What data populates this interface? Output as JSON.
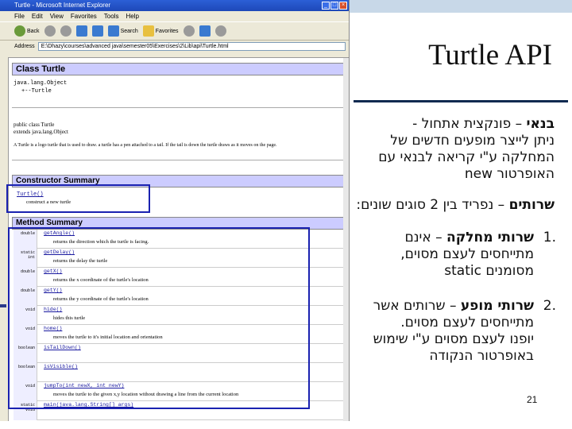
{
  "slide": {
    "title": "Turtle API",
    "block1": {
      "bold": "בנאי",
      "rest_line1": " – פונקצית אתחול -",
      "line2": "ניתן לייצר מופעים חדשים של",
      "line3": "המחלקה ע\"י קריאה לבנאי עם",
      "line4": "האופרטור new"
    },
    "block2": {
      "bold": "שרותים",
      "rest": " – נפריד בין 2 סוגים שונים:"
    },
    "item1": {
      "number": "1.",
      "bold": "שרותי מחלקה",
      "line1_rest": " – אינם",
      "line2": "מתייחסים לעצם מסוים,",
      "line3": "מסומנים static"
    },
    "item2": {
      "number": "2.",
      "bold": "שרותי מופע",
      "line1_rest": " – שרותים אשר",
      "line2": "מתייחסים לעצם מסוים.",
      "line3": "יופנו לעצם מסוים ע\"י שימוש",
      "line4": "באופרטור הנקודה"
    },
    "page_number": "21",
    "colors": {
      "title_rule": "#102a50",
      "highlight_box": "#1a22b0"
    }
  },
  "browser": {
    "title": "Turtle - Microsoft Internet Explorer",
    "window_buttons": [
      "_",
      "□",
      "×"
    ],
    "menu": [
      "File",
      "Edit",
      "View",
      "Favorites",
      "Tools",
      "Help"
    ],
    "toolbar": {
      "back": "Back",
      "search": "Search",
      "favorites": "Favorites"
    },
    "address_label": "Address",
    "address_value": "E:\\Dhazy\\courses\\advanced java\\semester05\\Exercises\\2\\Lib\\api\\Turtle.html",
    "page": {
      "class_title": "Class Turtle",
      "hierarchy_1": "java.lang.Object",
      "hierarchy_2": "+--Turtle",
      "decl_1": "public class Turtle",
      "decl_2": "extends java.lang.Object",
      "description": "A Turtle is a logo turtle that is used to draw. a turtle has a pen attached to a tail. If the tail is down the turtle draws as it moves on the page.",
      "constructor_header": "Constructor Summary",
      "constructor_sig": "Turtle()",
      "constructor_desc": "construct a new turtle",
      "method_header": "Method Summary",
      "methods": [
        {
          "modifier": "double",
          "sig": "getAngle()",
          "desc": "returns the direction which the turtle is facing."
        },
        {
          "modifier": "static int",
          "sig": "getDelay()",
          "desc": "returns the delay the turtle"
        },
        {
          "modifier": "double",
          "sig": "getX()",
          "desc": "returns the x coordinate of the turtle's location"
        },
        {
          "modifier": "double",
          "sig": "getY()",
          "desc": "returns the y coordinate of the turtle's location"
        },
        {
          "modifier": "void",
          "sig": "hide()",
          "desc": "hides this turtle"
        },
        {
          "modifier": "void",
          "sig": "home()",
          "desc": "moves the turtle to it's initial location and orientation"
        },
        {
          "modifier": "boolean",
          "sig": "isTailDown()",
          "desc": ""
        },
        {
          "modifier": "boolean",
          "sig": "isVisible()",
          "desc": ""
        },
        {
          "modifier": "void",
          "sig": "jumpTo(int newX, int newY)",
          "desc": "moves the turtle to the given x,y location without drawing a line from the current location"
        },
        {
          "modifier": "static void",
          "sig": "main(java.lang.String[] args)",
          "desc": ""
        }
      ]
    }
  }
}
